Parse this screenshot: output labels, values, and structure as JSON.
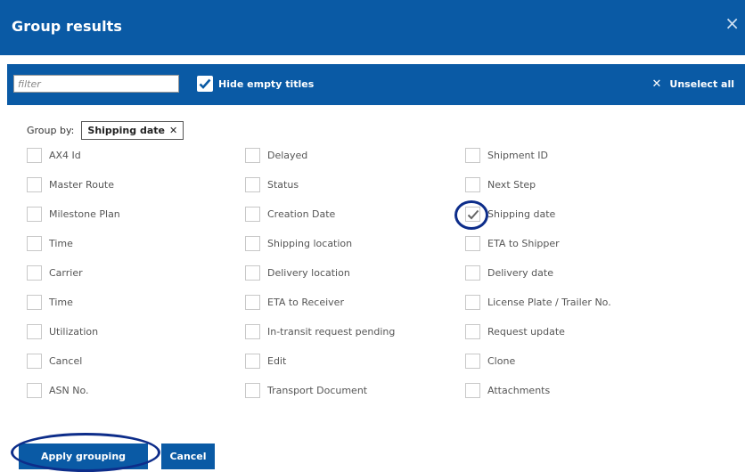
{
  "dialog": {
    "title": "Group results",
    "close_symbol": "×"
  },
  "toolbar": {
    "filter_placeholder": "filter",
    "filter_value": "",
    "hide_empty_label": "Hide empty titles",
    "hide_empty_checked": true,
    "unselect_symbol": "✕",
    "unselect_label": "Unselect all"
  },
  "groupby": {
    "label": "Group by:",
    "chip_label": "Shipping date",
    "chip_remove": "✕"
  },
  "columns": [
    [
      {
        "label": "AX4 Id",
        "checked": false
      },
      {
        "label": "Master Route",
        "checked": false
      },
      {
        "label": "Milestone Plan",
        "checked": false
      },
      {
        "label": "Time",
        "checked": false
      },
      {
        "label": "Carrier",
        "checked": false
      },
      {
        "label": "Time",
        "checked": false
      },
      {
        "label": "Utilization",
        "checked": false
      },
      {
        "label": "Cancel",
        "checked": false
      },
      {
        "label": "ASN No.",
        "checked": false
      }
    ],
    [
      {
        "label": "Delayed",
        "checked": false
      },
      {
        "label": "Status",
        "checked": false
      },
      {
        "label": "Creation Date",
        "checked": false
      },
      {
        "label": "Shipping location",
        "checked": false
      },
      {
        "label": "Delivery location",
        "checked": false
      },
      {
        "label": "ETA to Receiver",
        "checked": false
      },
      {
        "label": "In-transit request pending",
        "checked": false
      },
      {
        "label": "Edit",
        "checked": false
      },
      {
        "label": "Transport Document",
        "checked": false
      }
    ],
    [
      {
        "label": "Shipment ID",
        "checked": false
      },
      {
        "label": "Next Step",
        "checked": false
      },
      {
        "label": "Shipping date",
        "checked": true
      },
      {
        "label": "ETA to Shipper",
        "checked": false
      },
      {
        "label": "Delivery date",
        "checked": false
      },
      {
        "label": "License Plate / Trailer No.",
        "checked": false
      },
      {
        "label": "Request update",
        "checked": false
      },
      {
        "label": "Clone",
        "checked": false
      },
      {
        "label": "Attachments",
        "checked": false
      }
    ]
  ],
  "buttons": {
    "apply_label": "Apply grouping",
    "cancel_label": "Cancel"
  },
  "colors": {
    "primary": "#0a5aa5",
    "annotation_ring": "#0d2d8a"
  }
}
